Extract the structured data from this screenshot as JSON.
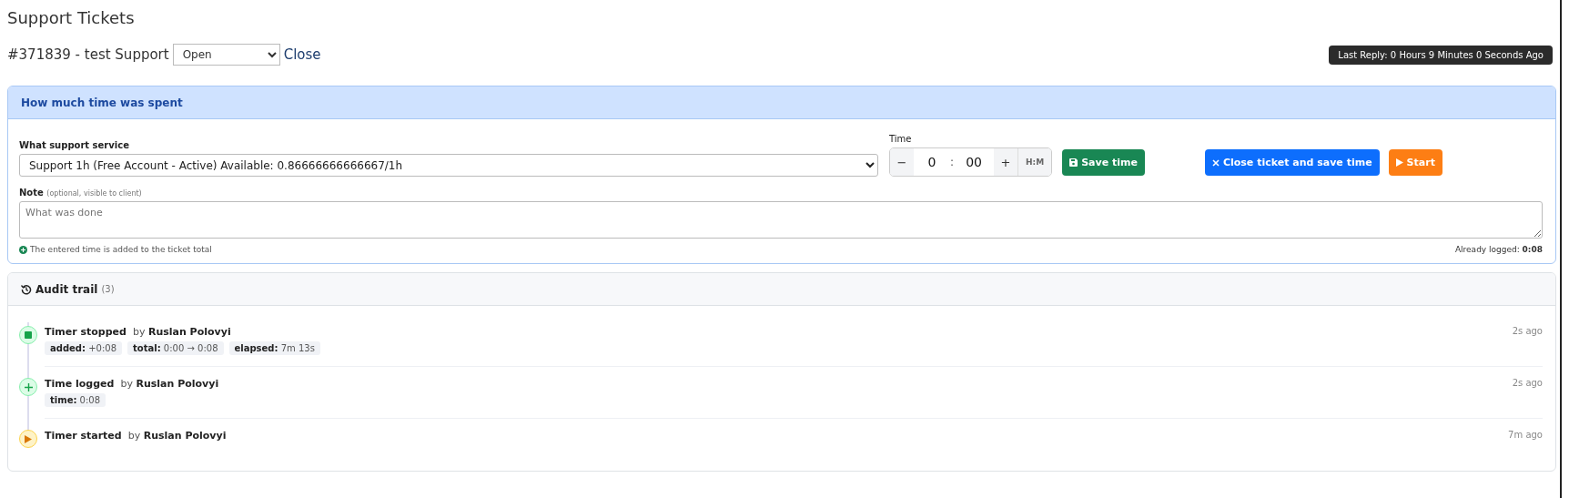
{
  "page_title": "Support Tickets",
  "ticket": {
    "label": "#371839 - test Support",
    "status": "Open",
    "close_link": "Close",
    "last_reply": "Last Reply: 0 Hours 9 Minutes 0 Seconds Ago"
  },
  "time_panel": {
    "title": "How much time was spent",
    "service_label": "What support service",
    "service": "Support 1h (Free Account - Active) Available: 0.86666666666667/1h",
    "time_label": "Time",
    "minus": "−",
    "hours": "0",
    "separator": ":",
    "minutes": "00",
    "plus": "+",
    "unit": "H:M",
    "buttons": [
      {
        "kind": "save",
        "label": "Save time"
      },
      {
        "kind": "close",
        "label": "Close ticket and save time"
      },
      {
        "kind": "start",
        "label": "Start"
      }
    ],
    "note_label": "Note",
    "note_hint": "(optional, visible to client)",
    "note_placeholder": "What was done",
    "info": "The entered time is added to the ticket total",
    "already_logged": "Already logged: **0:08**"
  },
  "audit": {
    "title": "Audit trail",
    "count": "(3)",
    "events": [
      {
        "kind": "stop",
        "title": "Timer stopped",
        "by": "by",
        "user": "Ruslan Polovyi",
        "time": "2s ago",
        "tags": [
          {
            "label": "added:",
            "value": "+0:08"
          },
          {
            "label": "total:",
            "value": "0:00 → 0:08"
          },
          {
            "label": "elapsed:",
            "value": "7m 13s"
          }
        ]
      },
      {
        "kind": "log",
        "title": "Time logged",
        "by": "by",
        "user": "Ruslan Polovyi",
        "time": "2s ago",
        "tags": [
          {
            "label": "time:",
            "value": "0:08"
          }
        ]
      },
      {
        "kind": "start",
        "title": "Timer started",
        "by": "by",
        "user": "Ruslan Polovyi",
        "time": "7m ago"
      }
    ]
  }
}
